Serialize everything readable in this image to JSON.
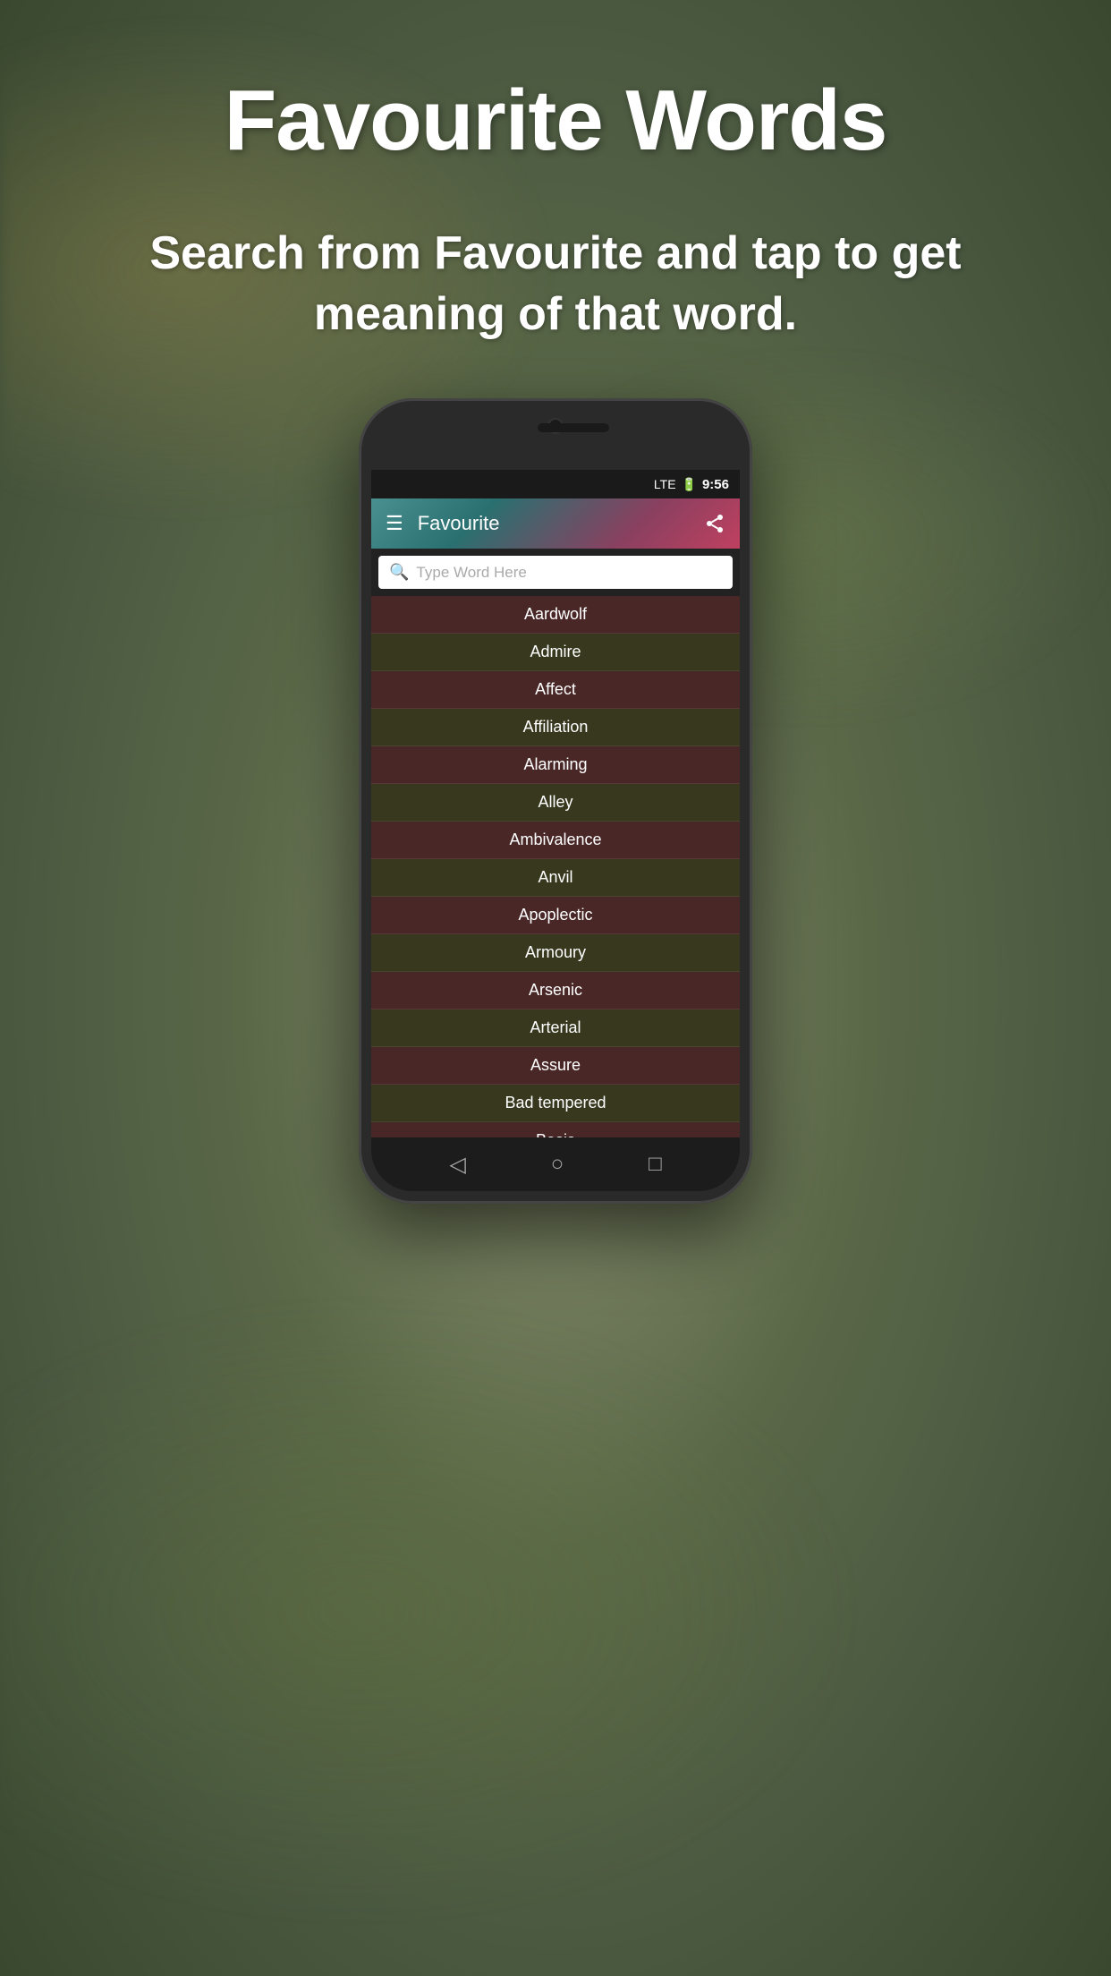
{
  "page": {
    "main_title": "Favourite Words",
    "subtitle": "Search from Favourite and tap to get meaning of that word.",
    "background_desc": "blurred bokeh outdoor background"
  },
  "phone": {
    "status_bar": {
      "signal": "LTE",
      "battery_icon": "🔋",
      "time": "9:56"
    },
    "app_bar": {
      "menu_icon": "☰",
      "title": "Favourite",
      "share_icon": "share"
    },
    "search": {
      "placeholder": "Type Word Here",
      "icon": "🔍"
    },
    "word_list": [
      {
        "word": "Aardwolf"
      },
      {
        "word": "Admire"
      },
      {
        "word": "Affect"
      },
      {
        "word": "Affiliation"
      },
      {
        "word": "Alarming"
      },
      {
        "word": "Alley"
      },
      {
        "word": "Ambivalence"
      },
      {
        "word": "Anvil"
      },
      {
        "word": "Apoplectic"
      },
      {
        "word": "Armoury"
      },
      {
        "word": "Arsenic"
      },
      {
        "word": "Arterial"
      },
      {
        "word": "Assure"
      },
      {
        "word": "Bad tempered"
      },
      {
        "word": "Basis"
      }
    ],
    "nav_bar": {
      "back_icon": "◁",
      "home_icon": "○",
      "recent_icon": "□"
    }
  }
}
